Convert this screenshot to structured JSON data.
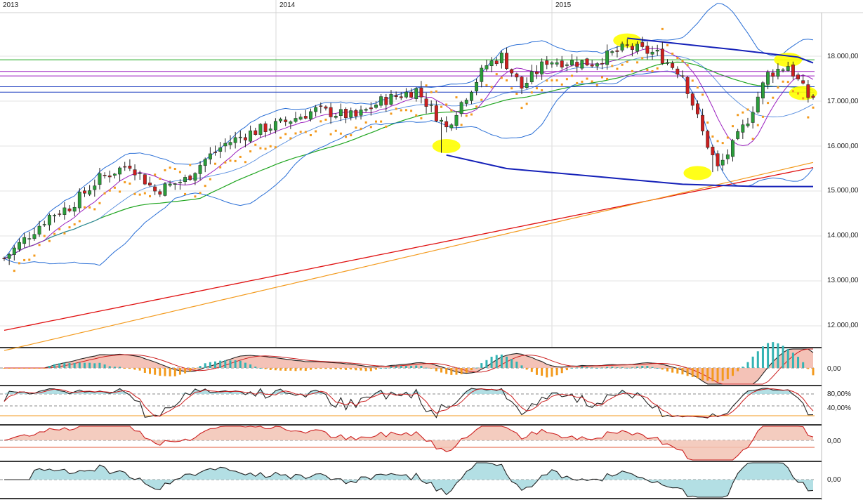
{
  "colors": {
    "up": "#2a9d3a",
    "down": "#cc1f1f",
    "bb": "#2a6fd6",
    "sma_fast": "#9b1fbf",
    "sma_mid": "#1fa51f",
    "sma_slow": "#e01010",
    "sma_long": "#f39a1d",
    "sar": "#f39a1d",
    "trend": "#1420b8",
    "highlight": "#ffff00",
    "hline_green": "#22aa22",
    "hline_purple": "#9b1fbf",
    "hline_blue": "#1f3fbf",
    "osc_fill": "#a6d9df",
    "osc_neg_fill": "#e6b7ad"
  },
  "chart_data": {
    "type": "candlestick",
    "years": [
      "2013",
      "2014",
      "2015"
    ],
    "price_ticks": [
      "18.000,00",
      "17.000,00",
      "16.000,00",
      "15.000,00",
      "14.000,00",
      "13.000,00",
      "12.000,00"
    ],
    "tick_values": [
      18000,
      17000,
      16000,
      15000,
      14000,
      13000,
      12000
    ],
    "ylim": [
      11500,
      19000
    ],
    "weeks_per_year": 52,
    "start_close": 13500,
    "anchors": [
      [
        0,
        13500
      ],
      [
        9,
        14450
      ],
      [
        13,
        14650
      ],
      [
        19,
        15280
      ],
      [
        25,
        15600
      ],
      [
        30,
        15000
      ],
      [
        36,
        15250
      ],
      [
        40,
        15700
      ],
      [
        44,
        16050
      ],
      [
        49,
        16300
      ],
      [
        55,
        16500
      ],
      [
        62,
        16800
      ],
      [
        70,
        16650
      ],
      [
        75,
        17000
      ],
      [
        82,
        17250
      ],
      [
        88,
        16400
      ],
      [
        90,
        16800
      ],
      [
        96,
        17800
      ],
      [
        99,
        18000
      ],
      [
        103,
        17300
      ],
      [
        108,
        17900
      ],
      [
        117,
        17850
      ],
      [
        124,
        18200
      ],
      [
        130,
        18050
      ],
      [
        135,
        17600
      ],
      [
        139,
        16300
      ],
      [
        142,
        15500
      ],
      [
        145,
        16000
      ],
      [
        148,
        16600
      ],
      [
        152,
        17600
      ],
      [
        156,
        17800
      ],
      [
        160,
        17100
      ]
    ],
    "horizontal_levels": [
      17920,
      17660,
      17560,
      17320,
      17200
    ],
    "trend_lines": [
      {
        "name": "upper",
        "points": [
          [
            124,
            18400
          ],
          [
            145,
            18150
          ],
          [
            158,
            17980
          ],
          [
            161,
            17850
          ]
        ]
      },
      {
        "name": "lower",
        "points": [
          [
            88,
            15800
          ],
          [
            100,
            15500
          ],
          [
            120,
            15300
          ],
          [
            135,
            15150
          ],
          [
            150,
            15100
          ],
          [
            161,
            15100
          ]
        ]
      }
    ],
    "highlights": [
      [
        88,
        16000
      ],
      [
        124,
        18350
      ],
      [
        138,
        15400
      ],
      [
        156,
        17920
      ],
      [
        159,
        17180
      ]
    ],
    "panels": [
      {
        "name": "MACD",
        "labels": [
          "0,00"
        ]
      },
      {
        "name": "Stochastic",
        "labels": [
          "80,00%",
          "40,00%"
        ]
      },
      {
        "name": "Oscillator",
        "labels": [
          "0,00"
        ]
      },
      {
        "name": "Momentum",
        "labels": [
          "0,00"
        ]
      }
    ]
  }
}
